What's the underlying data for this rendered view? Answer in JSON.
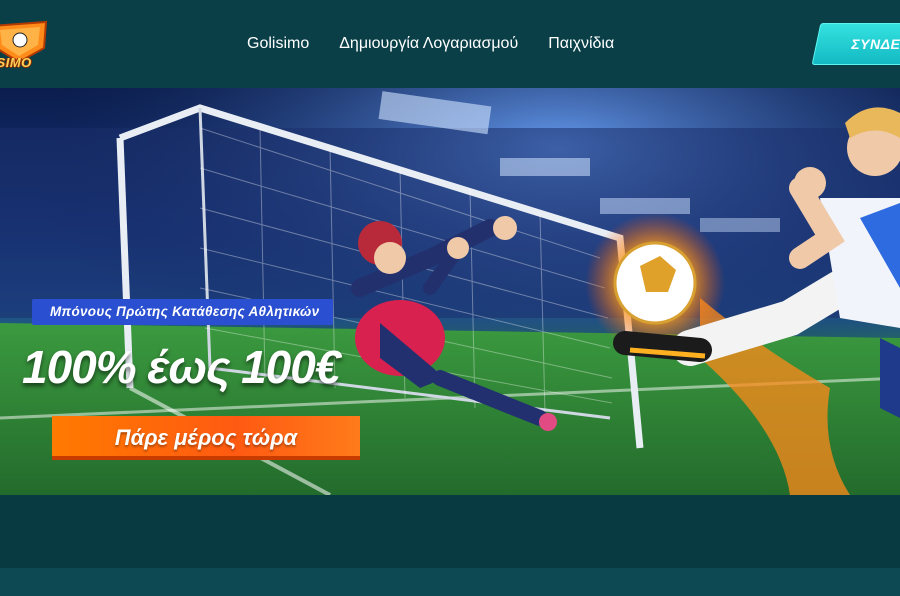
{
  "header": {
    "logo_text": "LISIMO",
    "nav": [
      "Golisimo",
      "Δημιουργία Λογαριασμού",
      "Παιχνίδια"
    ],
    "login_label": "ΣΥΝΔΕ"
  },
  "hero": {
    "promo_tag": "Μπόνους Πρώτης Κατάθεσης Αθλητικών",
    "headline": "100% έως 100€",
    "cta_label": "Πάρε μέρος τώρα"
  },
  "colors": {
    "header_bg": "#0b3f48",
    "accent_cyan": "#25d3d3",
    "cta_orange": "#ff6a00",
    "promo_blue": "#2a4fd0"
  }
}
